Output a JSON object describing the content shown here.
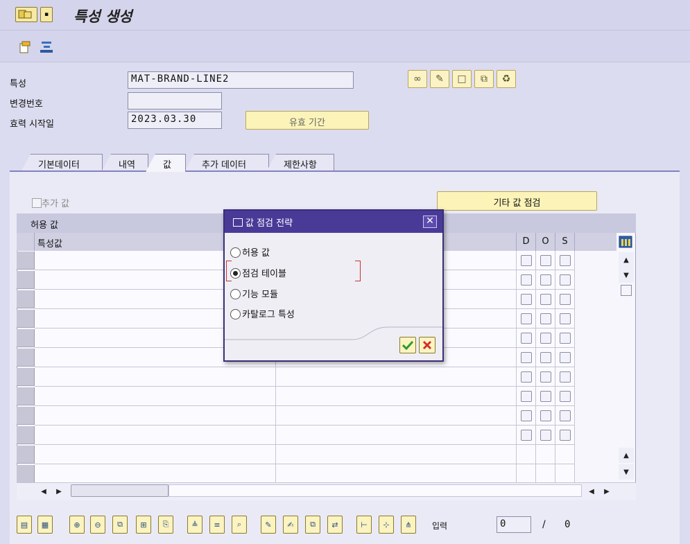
{
  "window": {
    "title": "특성 생성"
  },
  "header": {
    "characteristic_label": "특성",
    "characteristic_value": "MAT-BRAND-LINE2",
    "change_number_label": "변경번호",
    "change_number_value": "",
    "valid_from_label": "효력 시작일",
    "valid_from_value": "2023.03.30",
    "validity_button": "유효 기간"
  },
  "tabs": [
    {
      "label": "기본데이터",
      "active": false
    },
    {
      "label": "내역",
      "active": false
    },
    {
      "label": "값",
      "active": true
    },
    {
      "label": "추가 데이터",
      "active": false
    },
    {
      "label": "제한사항",
      "active": false
    }
  ],
  "values_tab": {
    "additional_values_label": "추가 값",
    "other_value_check_button": "기타 값 점검",
    "table_title": "허용 값",
    "columns": [
      "특성값",
      "D",
      "O",
      "S"
    ]
  },
  "dialog": {
    "title": "값 점검 전략",
    "options": [
      {
        "label": "허용 값",
        "selected": false
      },
      {
        "label": "점검 테이블",
        "selected": true
      },
      {
        "label": "기능 모듈",
        "selected": false
      },
      {
        "label": "카탈로그 특성",
        "selected": false
      }
    ]
  },
  "footer": {
    "entry_label": "입력",
    "entry_value": "0",
    "separator": "/",
    "total": "0"
  }
}
